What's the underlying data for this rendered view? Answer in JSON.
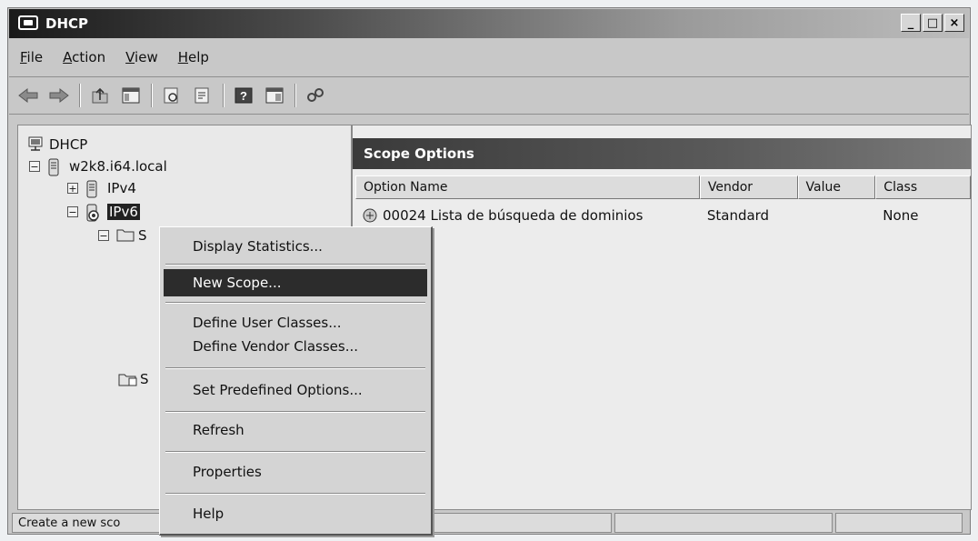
{
  "window": {
    "title": "DHCP"
  },
  "menubar": {
    "items": [
      "File",
      "Action",
      "View",
      "Help"
    ]
  },
  "toolbar": {
    "buttons": [
      "back-arrow-icon",
      "forward-arrow-icon",
      "up-folder-icon",
      "console-tree-icon",
      "export-list-icon",
      "properties-icon",
      "help-icon",
      "action-pane-icon",
      "connect-server-icon"
    ]
  },
  "tree": {
    "root": "DHCP",
    "server": "w2k8.i64.local",
    "ipv4": "IPv4",
    "ipv6": "IPv6",
    "partial_child": "S",
    "partial_child2": "S"
  },
  "right_pane": {
    "header": "Scope Options",
    "columns": [
      "Option Name",
      "Vendor",
      "Value",
      "Class"
    ],
    "rows": [
      {
        "option_name": "00024 Lista de búsqueda de dominios",
        "vendor": "Standard",
        "value": "",
        "class": "None"
      }
    ]
  },
  "context_menu": {
    "items": [
      {
        "label": "Display Statistics..."
      },
      {
        "label": "New Scope...",
        "highlighted": true
      },
      {
        "label": "Define User Classes..."
      },
      {
        "label": "Define Vendor Classes..."
      },
      {
        "label": "Set Predefined Options..."
      },
      {
        "label": "Refresh"
      },
      {
        "label": "Properties"
      },
      {
        "label": "Help"
      }
    ]
  },
  "statusbar": {
    "text": "Create a new sco"
  },
  "colors": {
    "highlight": "#2c2c2c",
    "pane_header": "#3a3a3a"
  }
}
